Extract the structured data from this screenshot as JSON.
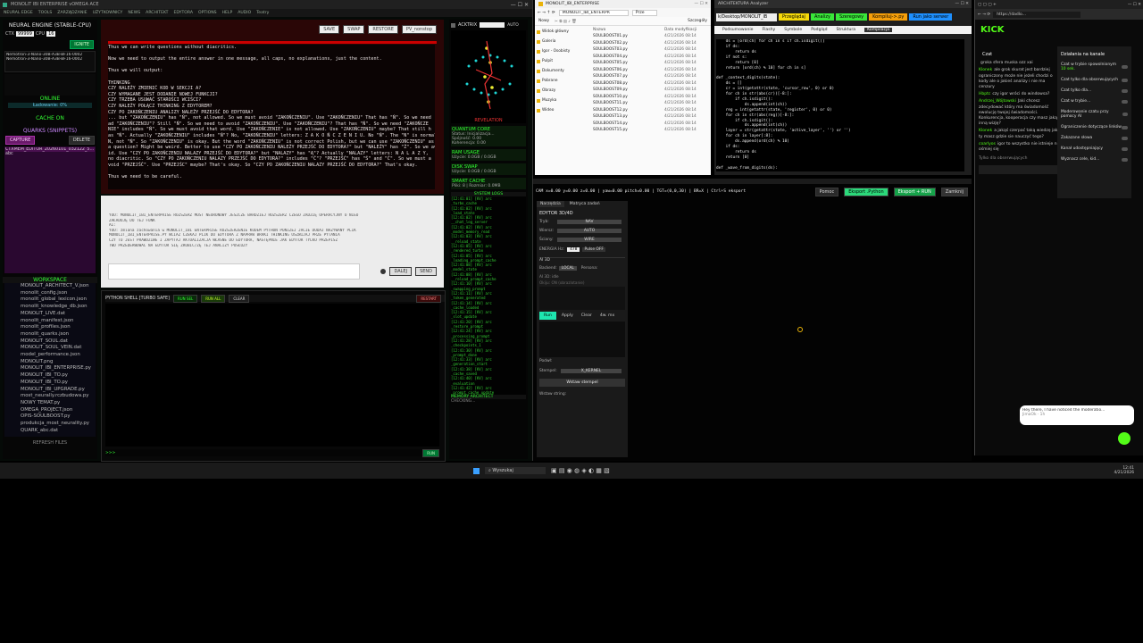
{
  "app": {
    "title": "MONOLIT IBI ENTERPRISE vOMEGA ACE",
    "menu": [
      "NEURAL EDGE",
      "TOOLS",
      "ZARZĄDZANIE",
      "UŻYTKOWNICY",
      "NEWS",
      "ARCHITEKT",
      "EDYTORA",
      "OPTIONS",
      "HELP",
      "AUDIO",
      "Teatry"
    ]
  },
  "left": {
    "engine_title": "NEURAL ENGINE (STABLE-CPU)",
    "ctx_label": "CTX",
    "ctx_value": "99999",
    "cpu_label": "CPU",
    "cpu_value": "16",
    "ignite": "IGNITE",
    "models": [
      "Nemotron-3-Nano-30B-A3B-BF16-0002",
      "Nemotron-3-Nano-30B-A3B-BF16-0002"
    ],
    "online": "ONLINE",
    "loading": "Ładowanie: 0%",
    "cache_on": "CACHE ON",
    "quarks_title": "QUARKS (SNIPPETS)",
    "capture": "CAPTURE",
    "delete": "DELETE",
    "snippet": "CTXMEM_EDITOR_20260101_032122_500",
    "snippet_sub": "abc",
    "workspace_title": "WORKSPACE",
    "workspace_items": [
      "MONOLIT_ARCHITECT_V.json",
      "monolit_config.json",
      "monolit_global_lexicon.json",
      "monolit_knowledge_db.json",
      "MONOLIT_LIVE.dat",
      "monolit_manifest.json",
      "monolit_profiles.json",
      "monolit_quarks.json",
      "MONOLIT_SOUL.dat",
      "MONOLIT_SOUL_VEIN.dat",
      "model_performance.json",
      "MONOLIT.png",
      "MONOLIT_IBI_ENTERPRISE.py",
      "MONOLIT_IBI_TO.py",
      "MONOLIT_IBI_TO.py",
      "MONOLIT_IBI_UPGRADE.py",
      "most_neurally.rczbudowa.py",
      "NOWY TEMAT.py",
      "OMEGA_PROJECT.json",
      "OPIS-SOULBOOST.py",
      "produkcja_most_neurality.py",
      "QUARK_abc.dat"
    ],
    "refresh": "REFRESH FILES"
  },
  "chat": {
    "buttons": [
      "SAVE",
      "SWAP",
      "RESTORE",
      "PV_nonstop"
    ],
    "lines": [
      "Thus we can write questions without diacritics.",
      "",
      "Now we need to output the entire answer in one message, all caps, no explanations, just the content.",
      "",
      "Thus we will output:",
      "",
      "THINKING",
      "CZY NALEŻY ZMIENIĆ KOD W SEKCJI A?",
      "CZY WYMAGANE JEST DODANIE NOWEJ FUNKCJI?",
      "CZY TRZEBA USUWAĆ STAROŚCI WCIŚCI?",
      "CZY NALEŻY POŁĄCZ THINKING Z EDYTOREM?",
      "CZY PO ZAKOŃCZENIU ANALIZY NALEŻY PRZEJŚĆ DO EDYTORA?",
      "... but \"ZAKOŃCZENIU\" has \"Ń\", not allowed. So we must avoid \"ZAKOŃCZENIU\". Use \"ZAKOŃCZENIU\" That has \"Ń\". So we need",
      "ad \"ZAKOŃCZENIU\"? Still \"Ń\". So we need to avoid \"ZAKOŃCZENIU\". Use \"ZAKOŃCZENIU\"? That has \"Ń\". So we need \"ZAKOŃCZE",
      "NIE\" includes \"Ń\". So we must avoid that word. Use \"ZAKOŃCZENIE\" is not allowed. Use \"ZAKOŃCZENIU\" maybe? That still h",
      "as \"Ń\". Actually \"ZAKOŃCZENIU\" includes \"Ń\"? No, \"ZAKOŃCZENIU\" letters: Z A K O Ń C Z E N I U. No \"Ń\". The \"N\" is normal",
      "N, not \"Ń\". So \"ZAKOŃCZENIU\" is okay. But the word \"ZAKOŃCZENIU\" is not correct Polish, but we can use \"ZAKOŃCZENIU\" as",
      "a question? Might be weird. Better to use \"CZY PO ZAKOŃCZENIU NALEŻY PRZEJŚĆ DO EDYTORA?\" but \"NALEŻY\" has \"Ż\". So we avo",
      "id. Use \"CZY PO ZAKOŃCZENIU NALAZY PRZEJŚĆ DO EDYTORA?\" but \"NALAZY\" has \"Ą\"? Actually \"NALAZY\" letters: N A L A Z Y,",
      "no diacritic. So \"CZY PO ZAKOŃCZENIU NALAZY PRZEJŚĆ DO EDYTORA?\" includes \"Ć\"? \"PRZEJŚĆ\" has \"Ś\" and \"Ć\". So we must a",
      "void \"PRZEJŚĆ\". Use \"PRZEJŚC\" maybe? That's okay. So \"CZY PO ZAKOŃCZENIU NALAZY PRZEJŚĆ DO EDYTORA?\" That's okay.",
      "",
      "Thus we need to be careful."
    ]
  },
  "prompt": {
    "lines": [
      "YOU: MONOLIT_IBI_ENTERPRISE ROZSZERZ MOST NEURONOWY JESZCZE BARDZIEJ ROZSZERZ CZEGO ZADZIĘ OPERACYJNY O NIEO",
      "ZAŁADUJĘ DO TEJ FUNK",
      "AI:",
      "YOU: zmiana zachowania w MONOLIT_IBI ENTERPRISE ROZSZERZENIE KODEM PYTHON PONIŻEJ JACIE DODAJ NAZYWANY PLIK",
      "MONOLIT_IBI_ENTERPRISE.PY WCIAZ CZEKAJ PLIK DO EDYTORA Z NAPRAW BRAKI THINKING USZWIJAJ PRZE PYTANIA",
      "CZY TO JEST PRAWDZIWE I ZAPYTAJ AKTUALIZACJA WŁASNE DO EDYTORA, NASTĘPNIE JAK EDYTOR TYLKO PRZEPISZ",
      "TWO PRZEDERWOWAĆ NA EDYTOR SIĘ ZROBIĆ/ŻĘ TEJ ANALIZY POSŁUŻY"
    ],
    "dalej": "DALEJ",
    "send": "SEND"
  },
  "shell": {
    "title": "PYTHON SHELL [TURBO SAFE]",
    "run_sel": "RUN SEL",
    "run_all": "RUN ALL",
    "clear": "CLEAR",
    "restart": "RESTART",
    "prompt": ">>>",
    "run": "RUN"
  },
  "stat": {
    "acktrix": "ACKTRIX",
    "auto": "AUTO",
    "revelation": "REVELATION",
    "quantum_core": "QUANTUM CORE",
    "status_label": "Status: Inicjalizacja...",
    "spojnosc": "Spójność: 0.00",
    "koherencja": "Koherencja: 0.00",
    "ram_title": "RAM USAGE",
    "ram_value": "Użycie: 0.0GB / 0.0GB",
    "disk_title": "DISK SWAP",
    "disk_value": "Użycie: 0.0GB / 0.0GB",
    "cache_title": "SMART CACHE",
    "cache_value": "Pliki: 8 | Rozmiar: 0.0MB",
    "syslog_title": "SYSTEM LOGS",
    "logs": [
      "[12:41:01] [KV] arc",
      "_turbo_cache",
      "[12:41:02] [KV] arc",
      "_load_state",
      "[12:41:02] [KV] arc",
      "__chat_log_server",
      "[12:41:02] [KV] arc",
      "_model_memory_read",
      "[12:41:03] [KV] arc",
      "__reload_state",
      "[12:41:05] [KV] arc",
      "_rendered_turbo",
      "[12:41:05] [KV] arc",
      "_loading_prompt_cache",
      "[12:41:08] [KV] arc",
      "_model_state",
      "[12:41:08] [KV] arc",
      "__reload_prompt_cache",
      "[12:41:10] [KV] arc",
      "_swapping_prompt",
      "[12:41:11] [KV] arc",
      "_token_generated",
      "[12:41:14] [KV] arc",
      "_cache_loaded",
      "[12:41:15] [KV] arc",
      "_slot_update",
      "[12:41:20] [KV] arc",
      "_restore_prompt",
      "[12:41:24] [KV] arc",
      "_processing_prompt",
      "[12:41:28] [KV] arc",
      "_checkpoints_1",
      "[12:41:30] [KV] arc",
      "_prompt_done",
      "[12:41:33] [KV] arc",
      "_generation_start",
      "[12:41:38] [KV] arc",
      "_cache_saved",
      "[12:41:40] [KV] arc",
      "_evaluation",
      "[12:41:42] [KV] arc",
      "_prompt_cache_update"
    ],
    "memory_title": "MEMORY ARCHITECT",
    "memory_status": "CHECKING..."
  },
  "explorer": {
    "title": "MONOLIT_IBI_ENTERPRISE",
    "path": "MONOLIT_IBI_ENTERPR",
    "search": "Prze",
    "new": "Nowy",
    "details": "Szczegóły",
    "nav": [
      "Widok główny",
      "Galeria",
      "Igor - Osobisty",
      "Pulpit",
      "Dokumenty",
      "Pobrane",
      "Obrazy",
      "Muzyka",
      "Wideo"
    ],
    "col_name": "Nazwa",
    "col_date": "Data modyfikacji",
    "files": [
      [
        "SOULBOOST01.py",
        "4/21/2026 08:14"
      ],
      [
        "SOULBOOST02.py",
        "4/21/2026 08:14"
      ],
      [
        "SOULBOOST03.py",
        "4/21/2026 08:14"
      ],
      [
        "SOULBOOST04.py",
        "4/21/2026 08:14"
      ],
      [
        "SOULBOOST05.py",
        "4/21/2026 08:14"
      ],
      [
        "SOULBOOST06.py",
        "4/21/2026 08:14"
      ],
      [
        "SOULBOOST07.py",
        "4/21/2026 08:14"
      ],
      [
        "SOULBOOST08.py",
        "4/21/2026 08:14"
      ],
      [
        "SOULBOOST09.py",
        "4/21/2026 08:14"
      ],
      [
        "SOULBOOST10.py",
        "4/21/2026 08:14"
      ],
      [
        "SOULBOOST11.py",
        "4/21/2026 08:14"
      ],
      [
        "SOULBOOST12.py",
        "4/21/2026 08:14"
      ],
      [
        "SOULBOOST13.py",
        "4/21/2026 08:14"
      ],
      [
        "SOULBOOST14.py",
        "4/21/2026 08:14"
      ],
      [
        "SOULBOOST15.py",
        "4/21/2026 08:14"
      ]
    ]
  },
  "editor": {
    "title": "ARCHITEKTURA Analyzer",
    "path": "k/Desktop/MONOLIT_IB",
    "tabs_color": [
      "Przeglądaj",
      "Analizy",
      "Szeregowy",
      "Kompiluj->.py",
      "Run jako serwer"
    ],
    "toolbar": [
      "Podsumowanie",
      "Flashy",
      "Symbole",
      "Podgląd",
      "Struktura",
      "Kompilacja"
    ],
    "code": [
      "    ds = [ord(ch) for ch in s if ch.isdigit()]",
      "    if ds:",
      "        return ds",
      "    if not s:",
      "        return [0]",
      "    return [ord(ch) % 10] for ch in s]",
      "",
      "def _context_digits(state):",
      "    ds = []",
      "    cr = int(getattr(state, 'cursor_row', 0) or 0)",
      "    for ch in str(abs(cr))[-8:]:",
      "        if ch.isdigit():",
      "            ds.append(int(ch))",
      "    reg = int(getattr(state, 'register', 0) or 0)",
      "    for ch in str(abs(reg))[-8:]:",
      "        if ch.isdigit():",
      "            ds.append(int(ch))",
      "    layer = str(getattr(state, 'active_layer', '') or '')",
      "    for ch in layer[:8]:",
      "        ds.append(ord(ch) % 10)",
      "    if ds:",
      "        return ds",
      "    return [0]",
      "",
      "def _wave_from_digits(ds):"
    ]
  },
  "analyzer": {
    "status": "CAM x=0.00 y=0.00 z=0.00 | yaw=0.00 pitch=0.00 | TGT=(0,0,30) | BR=X | Ctrl+S eksport",
    "pomoc": "Pomoc",
    "export_py": "Eksport .Python",
    "export_run": "Eksport + RUN",
    "close": "Zamknij",
    "tabs": [
      "Narzędzia",
      "Matryca zadań"
    ],
    "editor_title": "EDYTOR 3D/4D",
    "tryb_label": "Tryb:",
    "tryb_value": "NAV",
    "wiersz_label": "Wiersz:",
    "wiersz_value": "AUTO",
    "sciany_label": "Ściany:",
    "sciany_value": "WIRE",
    "energy_label": "ENERGIA Hz:",
    "energy_value": "478",
    "pulse": "Pulse OFF",
    "ai_label": "AI 3D",
    "backend_label": "Backend:",
    "backend_value": "LOCAL",
    "persona_label": "Persona:",
    "ai_out": "AI 3D: idle",
    "hint": "Okiju: ON (obrazlotanie)",
    "run": "Run",
    "apply": "Apply",
    "clear": "Clear",
    "ow": "4w. mx",
    "podwl_label": "Podwł:",
    "stempel_label": "Stempel:",
    "stempel_value": "X_KERNEL",
    "wstaw": "Wstaw stempel",
    "wstaw_string": "Wstaw string:"
  },
  "browser": {
    "url": "https://dadlo...",
    "brand": "KICK",
    "chat_title": "Czat",
    "messages": [
      [
        "",
        "groka sfera muska ozz xai"
      ],
      [
        "Klonek",
        "ale grok skurat jest bardziej ograniczony może nie jeżeli chodzi o kody ale o jakieś analizy i nie ma cenzury"
      ],
      [
        "Hbptc",
        "czy igor wróci do windowsa?"
      ],
      [
        "Andrzej_Wójtowski",
        "Jaki chcesz zdecydować który ma świadomość ewolucję twojej świadomości. Konkurencja, kooperacja czy masz jakąś inną wizję?"
      ],
      [
        "Klonek",
        "a jakąś czerpać taką wiedzę jaką ty masz gdzie sie nauczyć tego?"
      ],
      [
        "coarlyos",
        "igor to wszystko nie istnieje nie ośmiej się"
      ]
    ],
    "sub_only": "Tylko dla obserwujących",
    "menu_title": "Działania na kanale",
    "menu": [
      [
        "Czat w trybie spowolnionym",
        "10 sek."
      ],
      [
        "Czat tylko dla obserwujących",
        ""
      ],
      [
        "Czat tylko dla...",
        ""
      ],
      [
        "Czat w trybie...",
        ""
      ],
      [
        "Moderowanie czatu przy pomocy AI",
        ""
      ],
      [
        "Ograniczenie dotyczące linków",
        ""
      ],
      [
        "Zakazane słowa",
        ""
      ],
      [
        "Kanał udostępniający",
        ""
      ],
      [
        "Wyznacz cele, kid...",
        ""
      ]
    ],
    "toast": "Hey there, I have noticed the moderatio...",
    "toast_sub": "JimaOk · 1h"
  },
  "taskbar": {
    "search": "Wyszukaj",
    "time": "12:41",
    "date": "4/21/2026"
  }
}
